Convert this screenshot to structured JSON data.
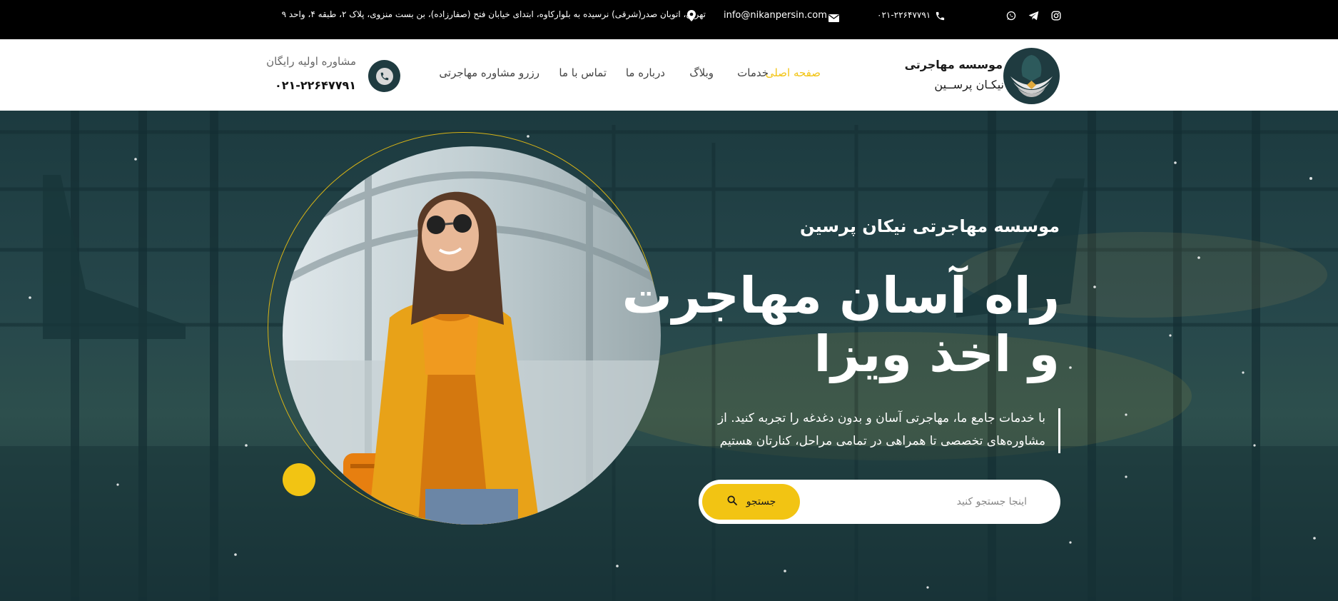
{
  "topbar": {
    "address": "تهران، اتوبان صدر(شرقی) نرسیده به بلوارکاوه، ابتدای خیابان فتح (صفارزاده)، بن بست منزوی، پلاک ۲، طبقه ۴، واحد ۹",
    "email": "info@nikanpersin.com",
    "phone": "۰۲۱-۲۲۶۴۷۷۹۱",
    "icons": [
      "location-pin-icon",
      "envelope-icon",
      "phone-icon",
      "whatsapp-icon",
      "telegram-icon",
      "instagram-icon"
    ]
  },
  "header": {
    "logo_line1": "موسسه مهاجرتی",
    "logo_line2": "نیکـان پرســین",
    "nav": [
      {
        "label": "صفحه اصلی",
        "active": true
      },
      {
        "label": "خدمات",
        "active": false
      },
      {
        "label": "وبلاگ",
        "active": false
      },
      {
        "label": "درباره ما",
        "active": false
      },
      {
        "label": "تماس با ما",
        "active": false
      },
      {
        "label": "رزرو مشاوره مهاجرتی",
        "active": false
      }
    ],
    "consult_label": "مشاوره اولیه رایگان",
    "consult_phone": "۰۲۱-۲۲۶۴۷۷۹۱"
  },
  "hero": {
    "subtitle": "موسسه مهاجرتی نیکان پرسین",
    "title_line1": "راه آسان مهاجرت",
    "title_line2": "و اخذ ویزا",
    "description": "با خدمات جامع ما، مهاجرتی آسان و بدون دغدغه را تجربه کنید. از مشاوره‌های تخصصی تا همراهی در تمامی مراحل، کنارتان هستیم",
    "search": {
      "placeholder": "اینجا جستجو کنید",
      "value": "",
      "button_label": "جستجو"
    }
  },
  "colors": {
    "accent": "#f2c413",
    "dark_teal": "#1f3b40",
    "topbar_bg": "#000000"
  }
}
